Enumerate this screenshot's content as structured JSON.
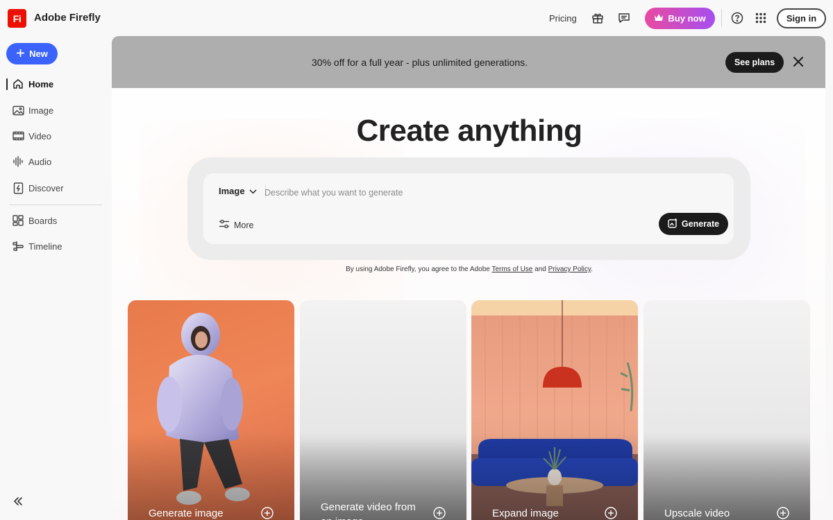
{
  "app": {
    "logo_text": "Fi",
    "name": "Adobe Firefly"
  },
  "topbar": {
    "pricing": "Pricing",
    "buy_now": "Buy now",
    "sign_in": "Sign in",
    "icons": [
      "gift-icon",
      "feedback-icon",
      "crown-icon",
      "help-icon",
      "apps-grid-icon"
    ]
  },
  "sidebar": {
    "new_label": "New",
    "items": [
      {
        "label": "Home",
        "icon": "home-icon",
        "active": true
      },
      {
        "label": "Image",
        "icon": "image-icon"
      },
      {
        "label": "Video",
        "icon": "video-icon"
      },
      {
        "label": "Audio",
        "icon": "audio-icon"
      },
      {
        "label": "Discover",
        "icon": "discover-icon"
      },
      {
        "label": "Boards",
        "icon": "boards-icon"
      },
      {
        "label": "Timeline",
        "icon": "timeline-icon"
      }
    ]
  },
  "promo": {
    "text": "30% off for a full year - plus unlimited generations.",
    "button": "See plans"
  },
  "hero": {
    "headline": "Create anything",
    "type_selected": "Image",
    "placeholder": "Describe what you want to generate",
    "more": "More",
    "generate": "Generate"
  },
  "terms": {
    "prefix": "By using Adobe Firefly, you agree to the Adobe",
    "terms_link": "Terms of Use",
    "and": "and",
    "privacy_link": "Privacy Policy",
    "suffix": "."
  },
  "cards": [
    {
      "label": "Generate image"
    },
    {
      "label_line1": "Generate video from",
      "label_line2": "an image"
    },
    {
      "label": "Expand image"
    },
    {
      "label": "Upscale video"
    }
  ],
  "colors": {
    "brand_red": "#eb1000",
    "new_blue": "#3b63fb",
    "buy_gradient_start": "#e94aa0",
    "buy_gradient_end": "#a54ff0"
  }
}
